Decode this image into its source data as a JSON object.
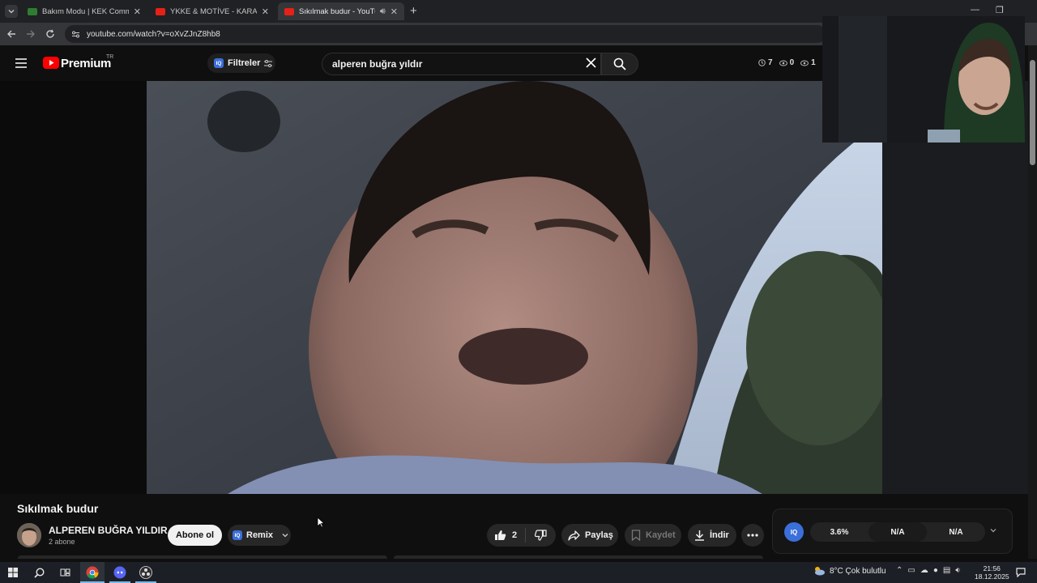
{
  "browser": {
    "tabs": [
      {
        "title": "Bakım Modu | KEK Community",
        "favicon_color": "#2e7d32"
      },
      {
        "title": "YKKE & MOTİVE - KARANLIK (O",
        "favicon_color": "#e62117"
      },
      {
        "title": "Sıkılmak budur - YouTube",
        "favicon_color": "#e62117"
      }
    ],
    "url": "youtube.com/watch?v=oXvZJnZ8hb8"
  },
  "youtube": {
    "brand": "Premium",
    "region": "TR",
    "filters_label": "Filtreler",
    "search_value": "alperen buğra yıldır",
    "stats": {
      "clock": "7",
      "eye": "0",
      "view": "1"
    }
  },
  "video": {
    "title": "Sıkılmak budur",
    "channel": "ALPEREN BUĞRA YILDIR",
    "subscribers": "2 abone",
    "subscribe_label": "Abone ol",
    "remix_label": "Remix",
    "likes": "2",
    "share_label": "Paylaş",
    "save_label": "Kaydet",
    "download_label": "İndir"
  },
  "iq_panel": {
    "badge": "IQ",
    "metrics": [
      "3.6%",
      "N/A",
      "N/A"
    ]
  },
  "taskbar": {
    "weather": "8°C  Çok bulutlu",
    "time": "21:56",
    "date": "18.12.2025"
  },
  "colors": {
    "accent": "#3b6fd9",
    "youtube_red": "#ff0000",
    "background": "#0f0f0f"
  }
}
